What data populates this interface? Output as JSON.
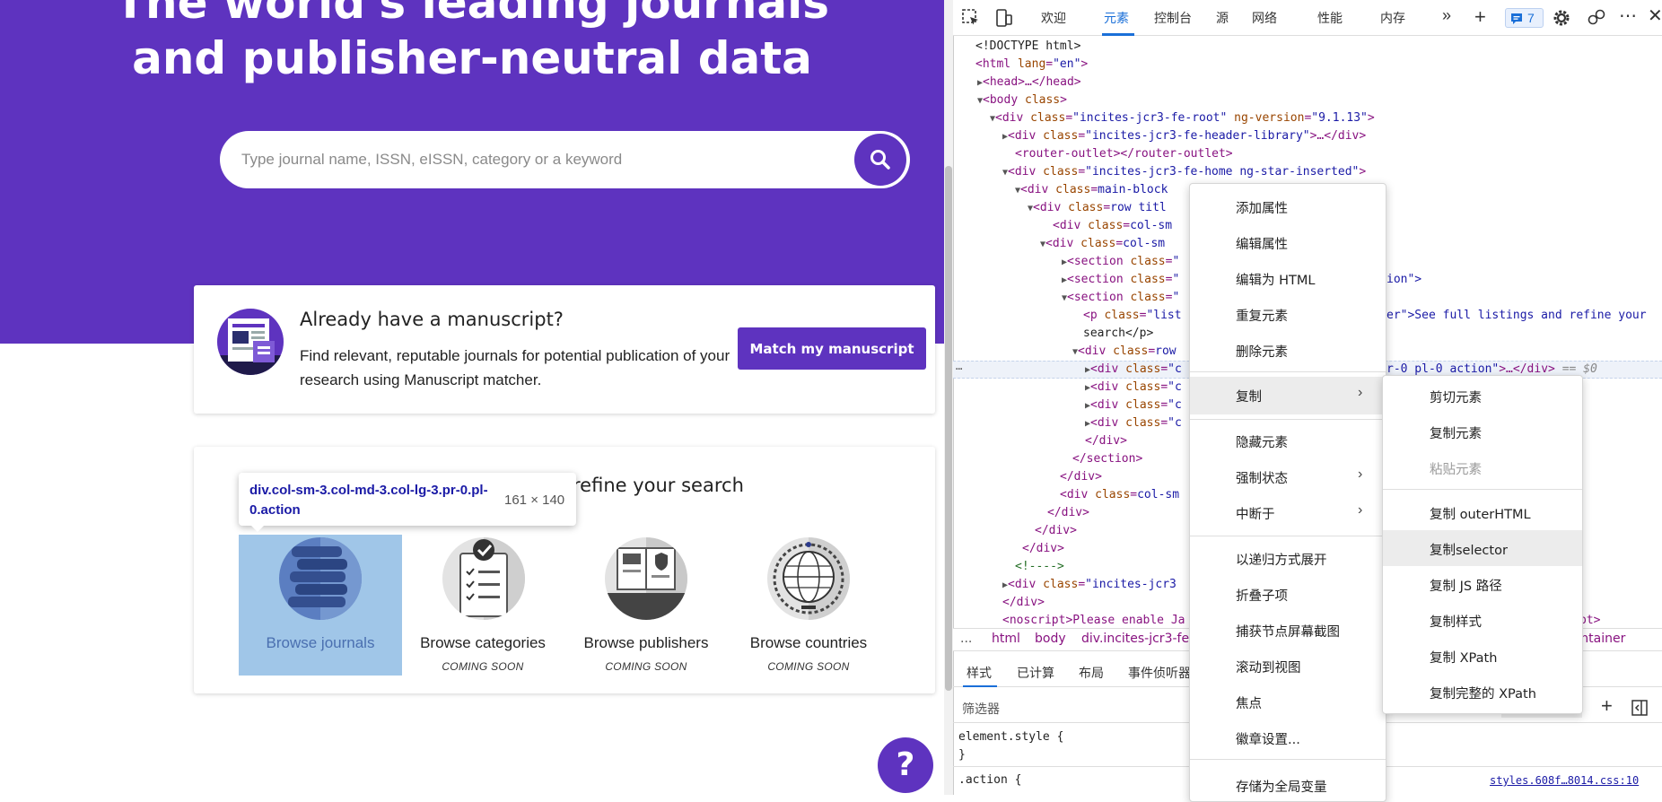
{
  "hero": {
    "title_line1": "The world's leading journals",
    "title_line2": "and publisher-neutral data",
    "search_placeholder": "Type journal name, ISSN, eISSN, category or a keyword",
    "search_icon": "search-icon"
  },
  "manuscript_card": {
    "title": "Already have a manuscript?",
    "description": "Find relevant, reputable journals for potential publication of your research using Manuscript matcher.",
    "button": "Match my manuscript"
  },
  "browse_card": {
    "title_partial": "refine your search",
    "tiles": [
      {
        "label": "Browse journals",
        "soon": ""
      },
      {
        "label": "Browse categories",
        "soon": "COMING SOON"
      },
      {
        "label": "Browse publishers",
        "soon": "COMING SOON"
      },
      {
        "label": "Browse countries",
        "soon": "COMING SOON"
      }
    ]
  },
  "tooltip": {
    "selector": "div.col-sm-3.col-md-3.col-lg-3.pr-0.pl-0.action",
    "size": "161 × 140"
  },
  "help_button": "?",
  "devtools": {
    "tabs": [
      "欢迎",
      "元素",
      "控制台",
      "源",
      "网络",
      "性能",
      "内存"
    ],
    "active_tab": "元素",
    "issues_count": "7",
    "dom_lines": {
      "l1": "<!DOCTYPE html>",
      "l2_tag": "<html",
      "l2_attr": "lang",
      "l2_val": "\"en\"",
      "l3": "<head>…</head>",
      "l4": "<body",
      "l4_attr": "class",
      "l5_val": "\"incites-jcr3-fe-root\"",
      "l5_ver": "\"9.1.13\"",
      "l6_val": "\"incites-jcr3-fe-header-library\"",
      "l7": "<router-outlet></router-outlet>",
      "l8_val": "\"incites-jcr3-fe-home ng-star-inserted\"",
      "l9": "main-block",
      "l10": "row titl",
      "l11": "col-sm",
      "l12": "col-sm",
      "l13": "section",
      "l14": "section",
      "l14_tail": "ion\">",
      "l15": "section",
      "l16_tag": "<p",
      "l16_val": "\"list",
      "l16_tail": "er\">See full listings and refine your",
      "l17": "search</p>",
      "l18": "row",
      "l19_tail": "r-0 pl-0 action\"",
      "l19_eq": "== $0",
      "l20": "</div>",
      "l21": "</section>",
      "l22": "</div>",
      "l23": "col-sm",
      "l24": "</div>",
      "l25": "</div>",
      "l26": "</div>",
      "l27": "<!---->",
      "l28_val": "\"incites-jcr3",
      "l29": "</div>",
      "l30": "<noscript>Please enable Ja",
      "l30_tail": "pt>"
    },
    "breadcrumbs": [
      "...",
      "html",
      "body",
      "div.incites-jcr3-fe-",
      "container"
    ],
    "styles_tabs": [
      "样式",
      "已计算",
      "布局",
      "事件侦听器"
    ],
    "filter_placeholder": "筛选器",
    "style_rule1": "element.style {",
    "style_rule1_end": "}",
    "style_rule2": ".action {",
    "style_source": "styles.608f…8014.css:10"
  },
  "context_menu": {
    "items": [
      "添加属性",
      "编辑属性",
      "编辑为 HTML",
      "重复元素",
      "删除元素",
      "复制",
      "隐藏元素",
      "强制状态",
      "中断于",
      "以递归方式展开",
      "折叠子项",
      "捕获节点屏幕截图",
      "滚动到视图",
      "焦点",
      "徽章设置...",
      "存储为全局变量"
    ]
  },
  "copy_submenu": {
    "items": [
      "剪切元素",
      "复制元素",
      "粘贴元素",
      "复制 outerHTML",
      "复制selector",
      "复制 JS 路径",
      "复制样式",
      "复制 XPath",
      "复制完整的 XPath"
    ],
    "disabled": "粘贴元素",
    "highlighted": "复制selector"
  },
  "colors": {
    "brand_purple": "#5e33bf",
    "devtools_blue": "#1a6fd8",
    "highlight": "#6fa8dc"
  }
}
